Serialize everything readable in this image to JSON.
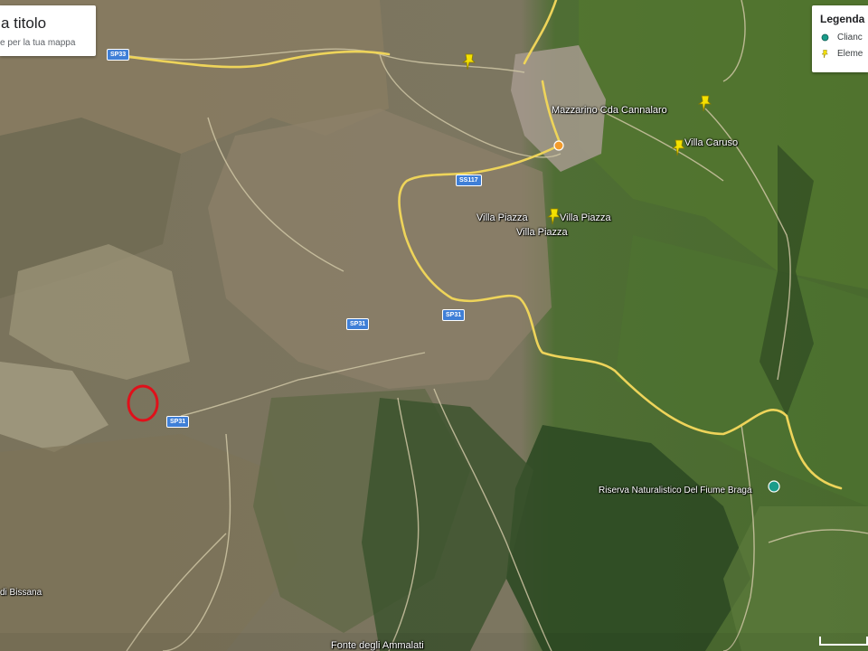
{
  "title_panel": {
    "title": "a titolo",
    "subtitle": "e per la tua mappa"
  },
  "legend": {
    "title": "Legenda",
    "items": [
      {
        "label": "Clianc",
        "icon": "teal-place-icon",
        "color": "#1a9c8a"
      },
      {
        "label": "Eleme",
        "icon": "yellow-pushpin-icon",
        "color": "#f5e100"
      }
    ]
  },
  "place_labels": {
    "villa_piazza_1": "Villa Piazza",
    "villa_piazza_2": "Villa Piazza",
    "villa_piazza_3": "Villa Piazza",
    "mazzarino": "Mazzarino Cda Cannalaro",
    "villa_caruso": "Villa Caruso",
    "riserva": "Riserva Naturalistico Del Fiume Braga",
    "fonte": "Fonte degli Ammalati",
    "bissana": "di Bissana"
  },
  "road_shields": {
    "sp33_top": "SP33",
    "ss117": "SS117",
    "sp31_mid": "SP31",
    "sp31_center": "SP31",
    "sp31_low": "SP31"
  },
  "colors": {
    "pin": "#f5e100",
    "highlight_circle": "#e0101a",
    "road_main": "#f0d55a",
    "road_minor": "#d9cfb0"
  }
}
